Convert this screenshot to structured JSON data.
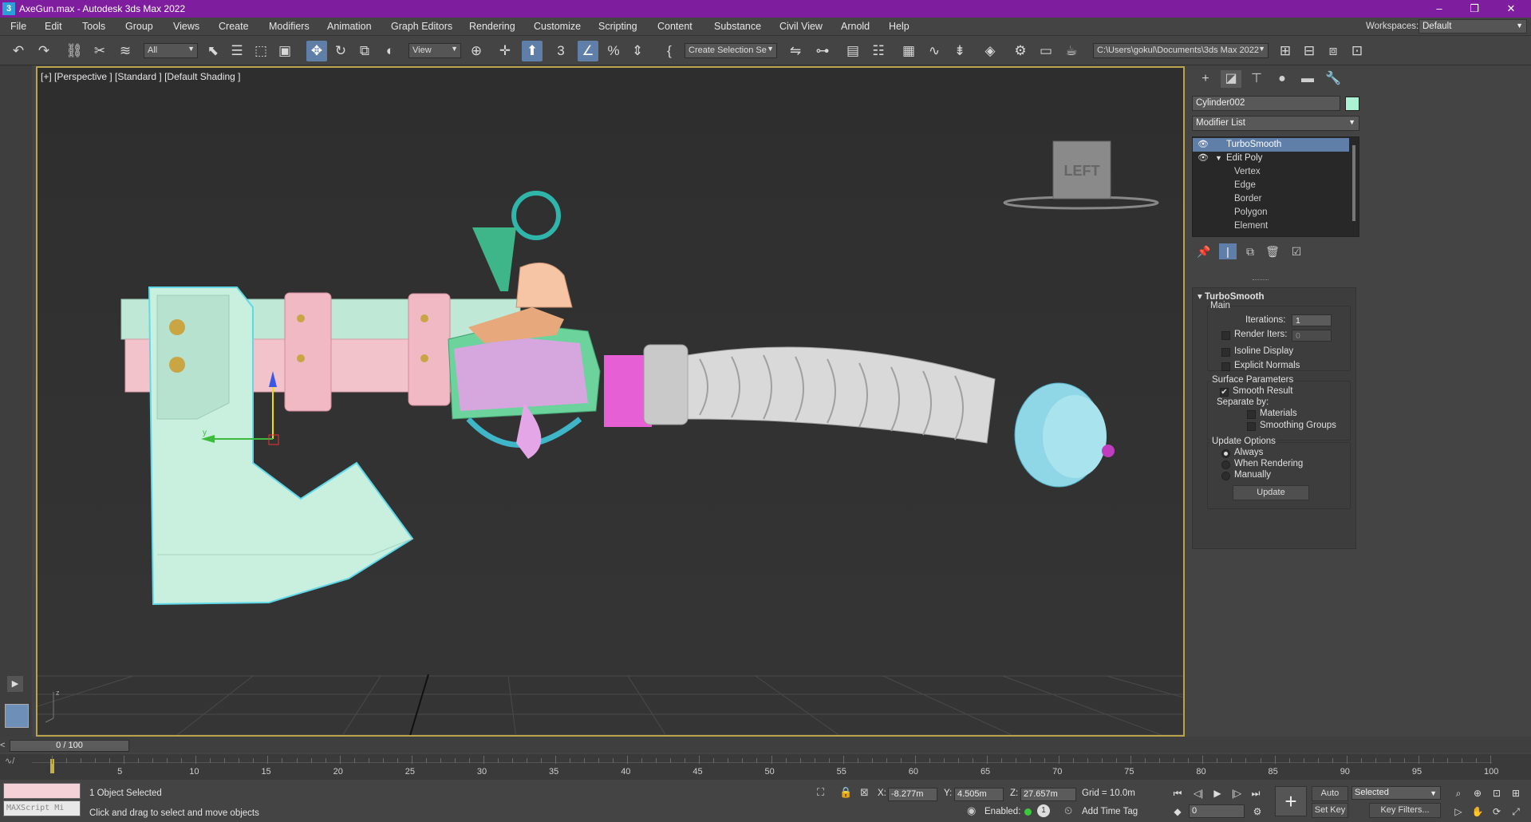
{
  "window": {
    "title": "AxeGun.max - Autodesk 3ds Max 2022",
    "app_icon": "3",
    "minimize": "–",
    "restore": "❐",
    "close": "✕"
  },
  "menu": {
    "items": [
      "File",
      "Edit",
      "Tools",
      "Group",
      "Views",
      "Create",
      "Modifiers",
      "Animation",
      "Graph Editors",
      "Rendering",
      "Customize",
      "Scripting",
      "Content",
      "Substance",
      "Civil View",
      "Arnold",
      "Help"
    ],
    "workspaces_label": "Workspaces:",
    "workspace_value": "Default"
  },
  "toolbar": {
    "selection_filter": "All",
    "ref_coord": "View",
    "selection_set": "Create Selection Se",
    "project_path": "C:\\Users\\gokul\\Documents\\3ds Max 2022"
  },
  "viewport": {
    "label": "[+] [Perspective ] [Standard ] [Default Shading ]",
    "viewcube_face": "LEFT",
    "axis_x": "x",
    "axis_y": "y",
    "axis_z": "z"
  },
  "command_panel": {
    "object_name": "Cylinder002",
    "modifier_list": "Modifier List",
    "stack": [
      {
        "label": "TurboSmooth",
        "selected": true
      },
      {
        "label": "Edit Poly"
      },
      {
        "label": "Vertex"
      },
      {
        "label": "Edge"
      },
      {
        "label": "Border"
      },
      {
        "label": "Polygon"
      },
      {
        "label": "Element"
      }
    ],
    "rollout": {
      "title": "TurboSmooth",
      "main": "Main",
      "iterations_label": "Iterations:",
      "iterations_value": "1",
      "render_iters_label": "Render Iters:",
      "render_iters_value": "0",
      "isoline": "Isoline Display",
      "explicit": "Explicit Normals",
      "surface_params": "Surface Parameters",
      "smooth_result": "Smooth Result",
      "separate_by": "Separate by:",
      "materials": "Materials",
      "smoothing_groups": "Smoothing Groups",
      "update_options": "Update Options",
      "always": "Always",
      "when_rendering": "When Rendering",
      "manually": "Manually",
      "update_button": "Update"
    }
  },
  "timeline": {
    "frame_display": "0 / 100",
    "prev": "<",
    "next": ">",
    "ticks": [
      "5",
      "10",
      "15",
      "20",
      "25",
      "30",
      "35",
      "40",
      "45",
      "50",
      "55",
      "60",
      "65",
      "70",
      "75",
      "80",
      "85",
      "90",
      "95",
      "100"
    ]
  },
  "status": {
    "maxscript_placeholder": "MAXScript Mi",
    "selected": "1 Object Selected",
    "prompt": "Click and drag to select and move objects",
    "x_label": "X:",
    "x_value": "-8.277m",
    "y_label": "Y:",
    "y_value": "4.505m",
    "z_label": "Z:",
    "z_value": "27.657m",
    "grid": "Grid = 10.0m",
    "enabled": "Enabled:",
    "add_time_tag": "Add Time Tag",
    "auto_key": "Auto Key",
    "selected_dropdown": "Selected",
    "set_key": "Set Key",
    "key_filters": "Key Filters...",
    "frame_field": "0"
  }
}
